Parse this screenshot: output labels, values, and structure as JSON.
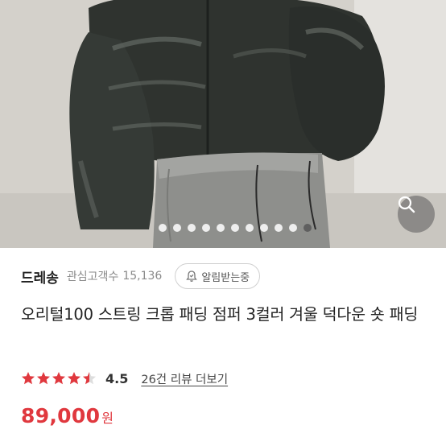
{
  "product": {
    "seller_name": "드레송",
    "follow_label": "관심고객수",
    "follow_count": "15,136",
    "alert_button_label": "알림받는중",
    "title": "오리털100 스트링 크롭 패딩 점퍼 3컬러 겨울 덕다운 숏 패딩",
    "rating_score": "4.5",
    "rating_value": 4.5,
    "rating_max": 5,
    "review_link": "26건 리뷰 더보기",
    "price": "89,000",
    "price_unit": "원"
  },
  "gallery": {
    "dot_count": 11,
    "active_index": 10,
    "zoom_icon": "search-icon"
  },
  "colors": {
    "price": "#e0383e",
    "star": "#e0383e"
  }
}
